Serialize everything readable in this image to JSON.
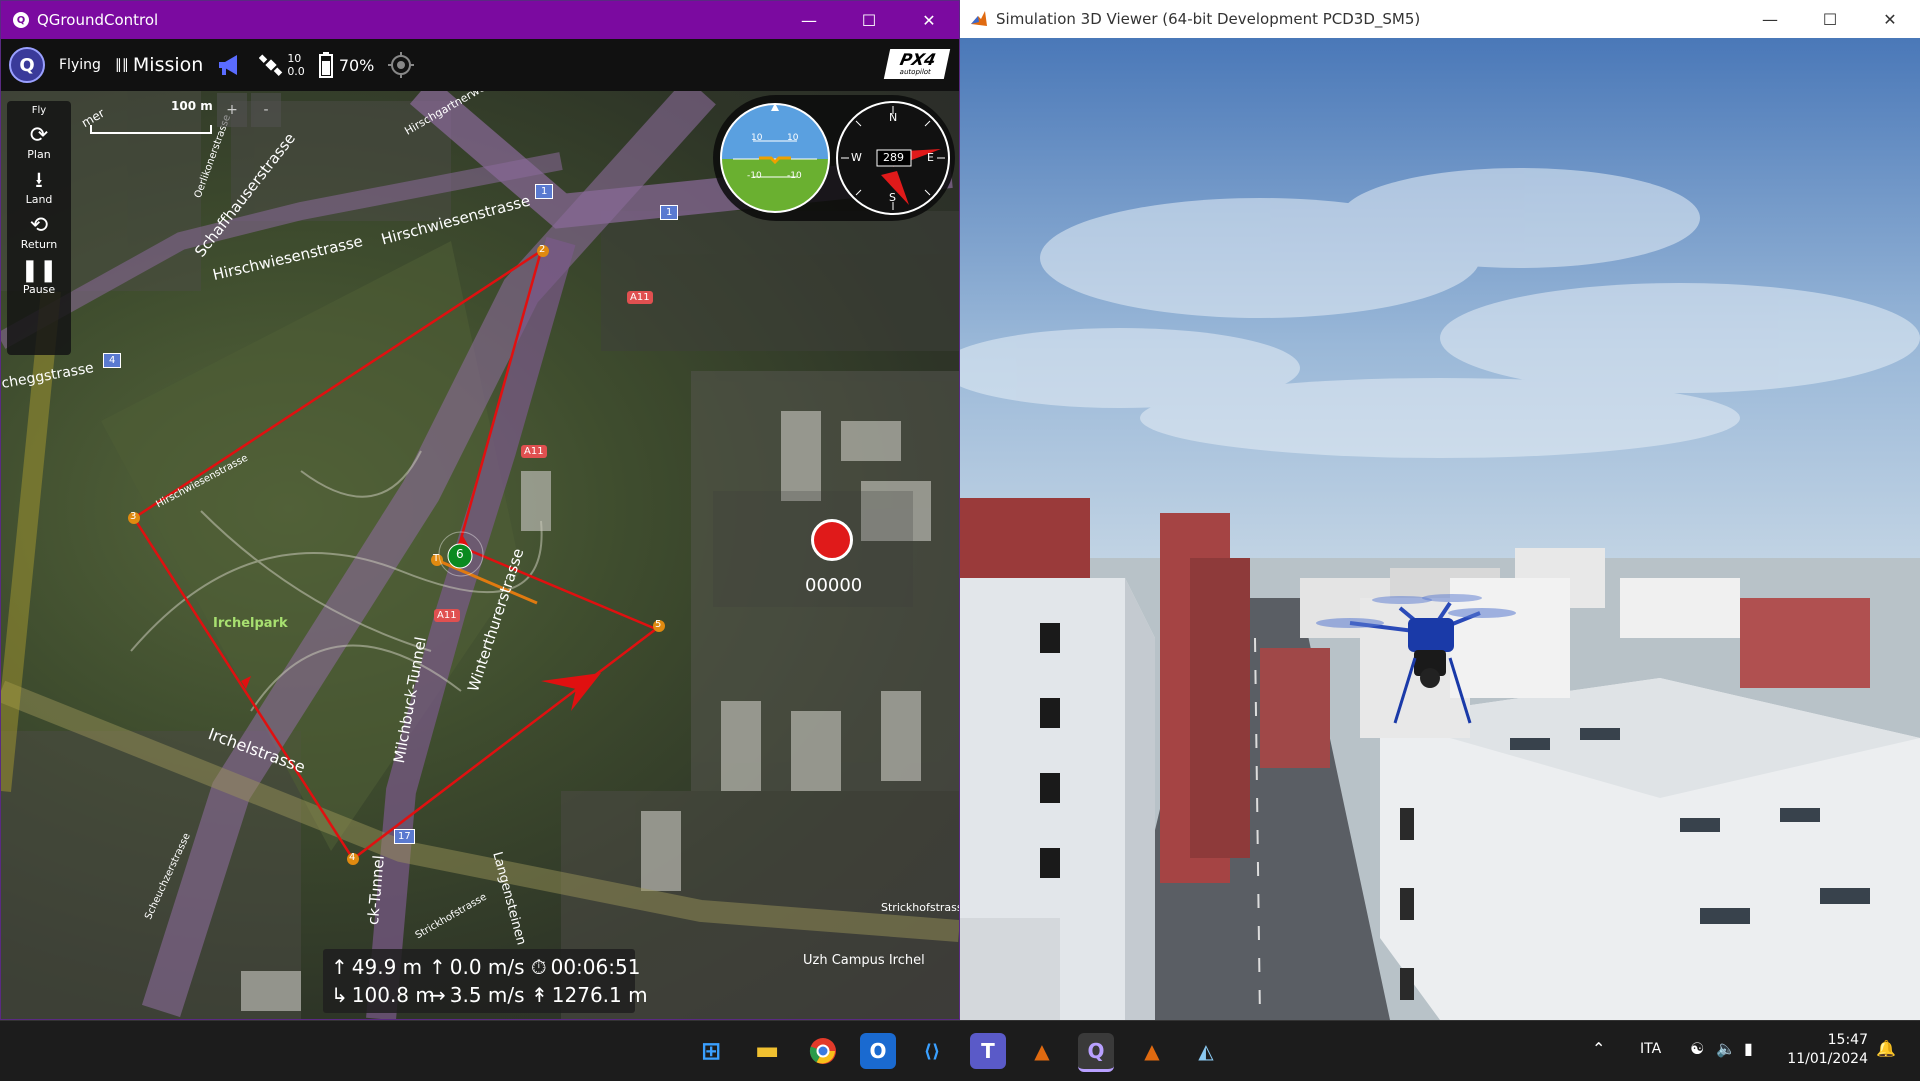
{
  "qgc": {
    "title": "QGroundControl",
    "toolbar": {
      "flight_status": "Flying",
      "mode": "Mission",
      "gps_count": "10",
      "gps_hdop": "0.0",
      "battery": "70%",
      "brand": "PX4",
      "brand_sub": "autopilot"
    },
    "left_toolbar": [
      {
        "label": "Fly",
        "icon": "fly-icon"
      },
      {
        "label": "Plan",
        "icon": "plan-icon"
      },
      {
        "label": "Land",
        "icon": "land-icon"
      },
      {
        "label": "Return",
        "icon": "return-icon"
      },
      {
        "label": "Pause",
        "icon": "pause-icon"
      }
    ],
    "scale_label": "100 m",
    "zoom_in": "+",
    "zoom_out": "-",
    "attitude": {
      "pitch_up": "10",
      "pitch_down": "-10"
    },
    "compass": {
      "heading": "289",
      "n": "N",
      "s": "S",
      "e": "E",
      "w": "W"
    },
    "map_labels": {
      "hirschgartnerweg": "Hirschgartnerweg",
      "schaffhauserstrasse": "Schaffhauserstrasse",
      "hirschwiesenstrasse1": "Hirschwiesenstrasse",
      "hirschwiesenstrasse2": "Hirschwiesenstrasse",
      "hirschwiesenstrasse3": "Hirschwiesenstrasse",
      "cheggstrasse": "cheggstrasse",
      "oerlikonerstrasse": "Oerlikonerstrasse",
      "irchelpark": "Irchelpark",
      "irchelstrasse": "Irchelstrasse",
      "milchbuck_tunnel": "Milchbuck-Tunnel",
      "winterthurerstrasse": "Winterthurerstrasse",
      "tunnel2": "ck-Tunnel",
      "langensteinen": "Langensteinen",
      "strickhofstrasse": "Strickhofstrasse",
      "strickhofstrass": "Strickhofstrass",
      "scheuchzerstrasse": "Scheuchzerstrasse",
      "uzh": "Uzh Campus Irchel",
      "a11": "A11",
      "r1": "1",
      "r4": "4",
      "r17": "17",
      "mer": "mer"
    },
    "waypoints": [
      "2",
      "3",
      "4",
      "5",
      "6",
      "T"
    ],
    "record_counter": "00000",
    "telemetry": {
      "altitude": "49.9 m",
      "vspeed": "0.0 m/s",
      "flight_time": "00:06:51",
      "distance": "100.8 m",
      "hspeed": "3.5 m/s",
      "dist_home": "1276.1 m"
    }
  },
  "sim": {
    "title": "Simulation 3D Viewer (64-bit Development PCD3D_SM5)"
  },
  "taskbar": {
    "apps": [
      {
        "name": "start",
        "label": "⊞"
      },
      {
        "name": "file-explorer",
        "label": "▬"
      },
      {
        "name": "chrome",
        "label": "●"
      },
      {
        "name": "outlook",
        "label": "O"
      },
      {
        "name": "vscode",
        "label": "⟨⟩"
      },
      {
        "name": "teams",
        "label": "T"
      },
      {
        "name": "matlab1",
        "label": "▲"
      },
      {
        "name": "qgroundcontrol",
        "label": "Q"
      },
      {
        "name": "matlab2",
        "label": "▲"
      },
      {
        "name": "monitor",
        "label": "◭"
      }
    ],
    "language": "ITA",
    "time": "15:47",
    "date": "11/01/2024"
  },
  "colors": {
    "qgc_title": "#7b0aa0",
    "mission_line": "#e01010",
    "record": "#e01a1a",
    "taskbar": "#1c1c1c"
  }
}
